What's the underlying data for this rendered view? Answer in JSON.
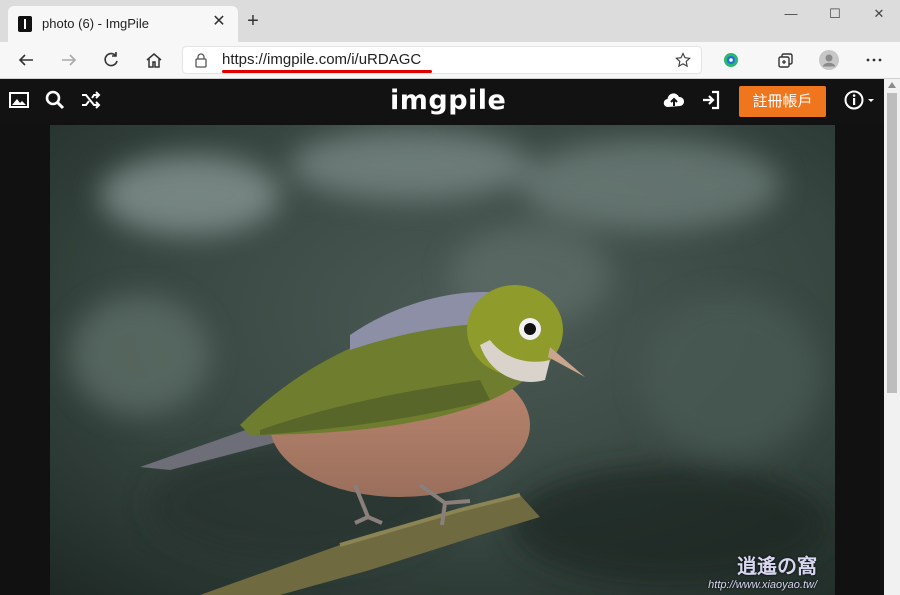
{
  "browser": {
    "tab_title": "photo (6) - ImgPile",
    "tab_close": "✕",
    "new_tab": "+",
    "window": {
      "minimize": "—",
      "maximize": "☐",
      "close": "✕"
    },
    "url": "https://imgpile.com/i/uRDAGC"
  },
  "site": {
    "logo": "imgpile",
    "signup_label": "註冊帳戶",
    "accent": "#f0761e"
  },
  "image": {
    "watermark_logo": "逍遙の窩",
    "watermark_url": "http://www.xiaoyao.tw/"
  }
}
